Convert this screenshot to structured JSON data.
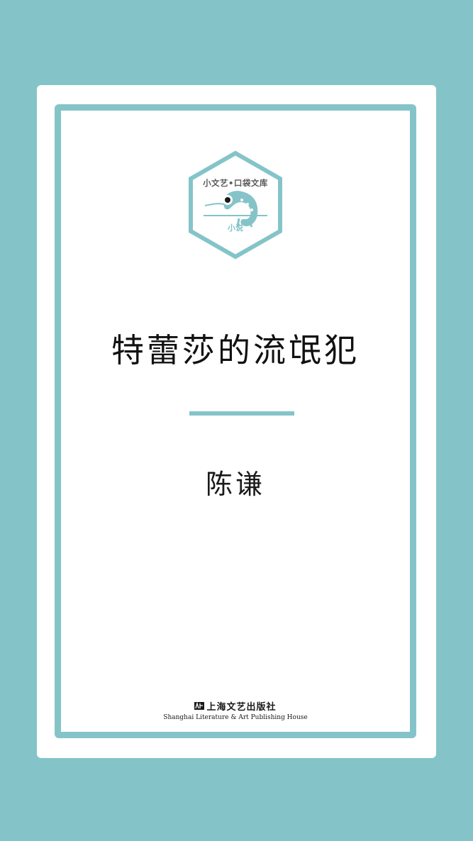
{
  "cover": {
    "series_label": "小文艺•口袋文库",
    "genre_label": "小说",
    "title": "特蕾莎的流氓犯",
    "author": "陈谦",
    "publisher_cn": "上海文艺出版社",
    "publisher_en": "Shanghai Literature & Art Publishing House",
    "emblem_icon": "chameleon-icon",
    "publisher_logo_icon": "publisher-logo-icon"
  },
  "colors": {
    "background": "#84c4c9",
    "accent": "#84c4c9",
    "card": "#ffffff",
    "text": "#111111"
  }
}
